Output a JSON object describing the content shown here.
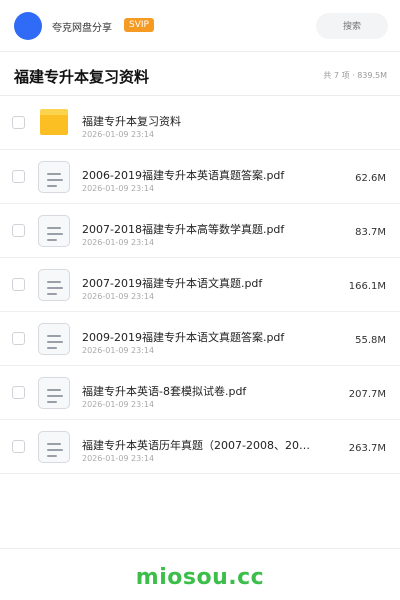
{
  "header": {
    "brand": "夸克网盘分享",
    "badge": "SVIP",
    "search_placeholder": "搜索"
  },
  "folder": {
    "title": "福建专升本复习资料",
    "summary": "共 7 项 · 839.5M"
  },
  "items": [
    {
      "type": "folder",
      "name": "福建专升本复习资料",
      "date": "2026-01-09 23:14",
      "size": ""
    },
    {
      "type": "file",
      "name": "2006-2019福建专升本英语真题答案.pdf",
      "date": "2026-01-09 23:14",
      "size": "62.6M"
    },
    {
      "type": "file",
      "name": "2007-2018福建专升本高等数学真题.pdf",
      "date": "2026-01-09 23:14",
      "size": "83.7M"
    },
    {
      "type": "file",
      "name": "2007-2019福建专升本语文真题.pdf",
      "date": "2026-01-09 23:14",
      "size": "166.1M"
    },
    {
      "type": "file",
      "name": "2009-2019福建专升本语文真题答案.pdf",
      "date": "2026-01-09 23:14",
      "size": "55.8M"
    },
    {
      "type": "file",
      "name": "福建专升本英语-8套模拟试卷.pdf",
      "date": "2026-01-09 23:14",
      "size": "207.7M"
    },
    {
      "type": "file",
      "name": "福建专升本英语历年真题（2007-2008、201…",
      "date": "2026-01-09 23:14",
      "size": "263.7M"
    }
  ],
  "footer": {
    "watermark": "miosou.cc"
  },
  "colors": {
    "avatar": "#2f6bf6",
    "badge": "#f59a23",
    "watermark": "#3bbf4a",
    "folder": "#fbbf24"
  },
  "icons": {
    "folder": "folder-icon",
    "file": "document-icon"
  }
}
